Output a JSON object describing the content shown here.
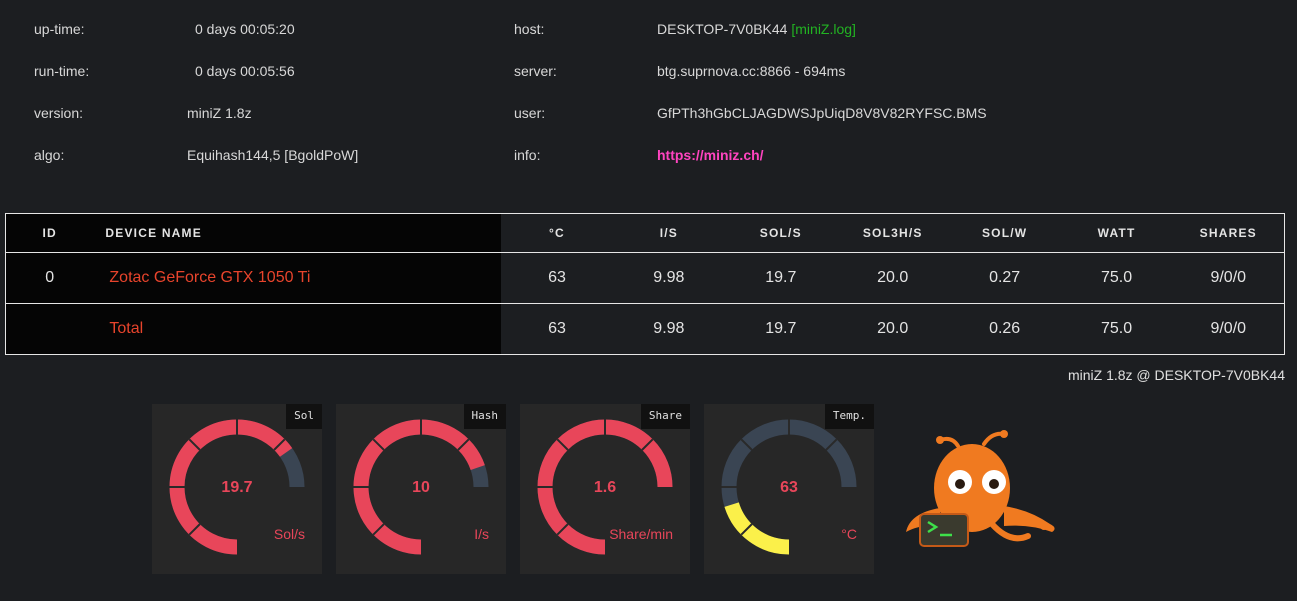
{
  "info": {
    "uptime_label": "up-time:",
    "uptime": "0 days 00:05:20",
    "runtime_label": "run-time:",
    "runtime": "0 days 00:05:56",
    "version_label": "version:",
    "version": "miniZ 1.8z",
    "algo_label": "algo:",
    "algo": "Equihash144,5 [BgoldPoW]",
    "host_label": "host:",
    "host": "DESKTOP-7V0BK44",
    "host_log": "[miniZ.log]",
    "server_label": "server:",
    "server": "btg.suprnova.cc:8866 - 694ms",
    "user_label": "user:",
    "user": "GfPTh3hGbCLJAGDWSJpUiqD8V8V82RYFSC.BMS",
    "info_label": "info:",
    "info_link": "https://miniz.ch/"
  },
  "table": {
    "headers": [
      "ID",
      "DEVICE NAME",
      "°C",
      "I/S",
      "SOL/S",
      "SOL3H/S",
      "SOL/W",
      "WATT",
      "SHARES"
    ],
    "rows": [
      [
        "0",
        "Zotac GeForce GTX 1050 Ti",
        "63",
        "9.98",
        "19.7",
        "20.0",
        "0.27",
        "75.0",
        "9/0/0"
      ],
      [
        "",
        "Total",
        "63",
        "9.98",
        "19.7",
        "20.0",
        "0.26",
        "75.0",
        "9/0/0"
      ]
    ]
  },
  "footer": "miniZ 1.8z @ DESKTOP-7V0BK44",
  "gauges": [
    {
      "tag": "Sol",
      "value": "19.7",
      "unit": "Sol/s",
      "fill": 0.87,
      "color": "#e8465a"
    },
    {
      "tag": "Hash",
      "value": "10",
      "unit": "I/s",
      "fill": 0.93,
      "color": "#e8465a"
    },
    {
      "tag": "Share",
      "value": "1.6",
      "unit": "Share/min",
      "fill": 1.0,
      "color": "#e8465a"
    },
    {
      "tag": "Temp.",
      "value": "63",
      "unit": "°C",
      "fill": 0.27,
      "color": "#fbf04a"
    }
  ],
  "colors": {
    "track": "#3a4553",
    "accent": "#e8465a",
    "device": "#e8442c",
    "log": "#22b422",
    "link": "#ff44c0"
  }
}
